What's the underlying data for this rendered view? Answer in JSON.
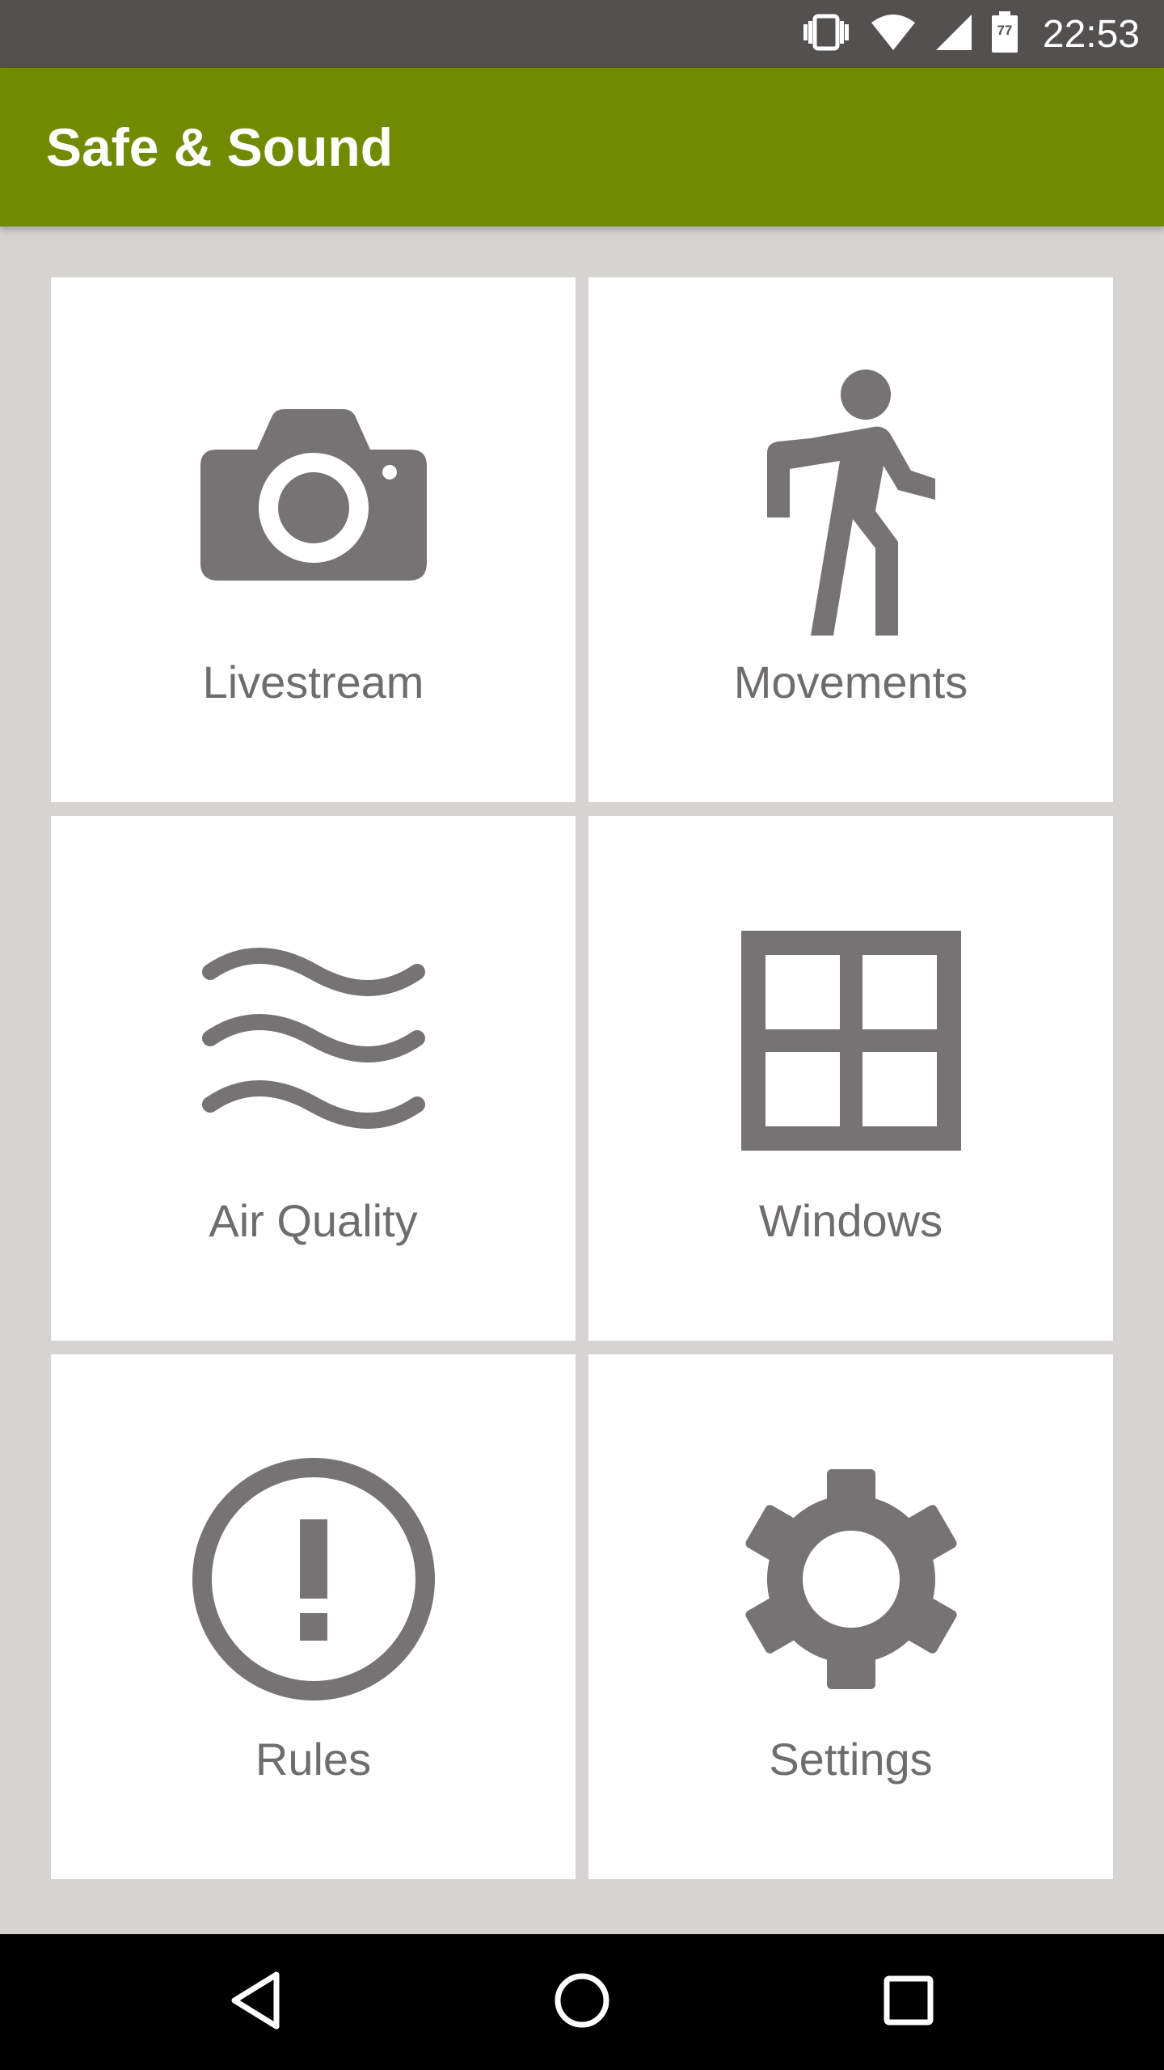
{
  "status_bar": {
    "time": "22:53",
    "battery_level": "77",
    "icons": [
      "vibrate-icon",
      "wifi-icon",
      "cell-signal-icon",
      "battery-icon"
    ]
  },
  "app_bar": {
    "title": "Safe & Sound",
    "color": "#718b01"
  },
  "tiles": [
    {
      "label": "Livestream",
      "icon": "camera-icon"
    },
    {
      "label": "Movements",
      "icon": "walking-person-icon"
    },
    {
      "label": "Air Quality",
      "icon": "air-waves-icon"
    },
    {
      "label": "Windows",
      "icon": "window-grid-icon"
    },
    {
      "label": "Rules",
      "icon": "alert-circle-icon"
    },
    {
      "label": "Settings",
      "icon": "gear-icon"
    }
  ],
  "nav_bar": {
    "buttons": [
      "back-icon",
      "home-icon",
      "recents-icon"
    ]
  },
  "colors": {
    "icon_gray": "#757373",
    "background": "#d5d4d3",
    "status_bar": "#535050"
  }
}
